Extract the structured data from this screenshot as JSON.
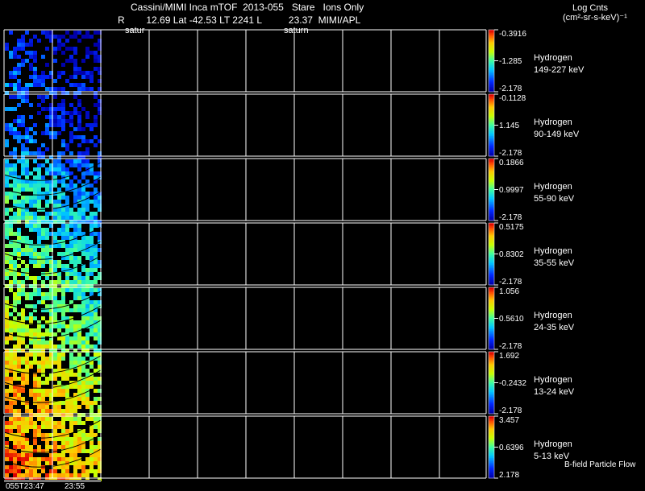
{
  "header": {
    "title": "Cassini/MIMI Inca mTOF  2013-055   Stare   Ions Only",
    "ephemeris": "R        12.69 Lat -42.53 LT 2241 L          23.37  MIMI/APL",
    "saturn_label_1": "satur",
    "saturn_label_2": "saturn",
    "units_title": "Log Cnts",
    "units": "(cm²-sr-s-keV)⁻¹"
  },
  "panels": [
    {
      "species": "Hydrogen",
      "energy": "149-227 keV",
      "cb_max": "-0.3916",
      "cb_mid": "-1.285",
      "cb_min": "-2.178",
      "level": 0.1
    },
    {
      "species": "Hydrogen",
      "energy": "90-149 keV",
      "cb_max": "-0.1128",
      "cb_mid": "1.145",
      "cb_min": "-2.178",
      "level": 0.15
    },
    {
      "species": "Hydrogen",
      "energy": "55-90 keV",
      "cb_max": "0.1866",
      "cb_mid": "0.9997",
      "cb_min": "-2.178",
      "level": 0.35
    },
    {
      "species": "Hydrogen",
      "energy": "35-55 keV",
      "cb_max": "0.5175",
      "cb_mid": "0.8302",
      "cb_min": "-2.178",
      "level": 0.45
    },
    {
      "species": "Hydrogen",
      "energy": "24-35 keV",
      "cb_max": "1.056",
      "cb_mid": "0.5610",
      "cb_min": "-2.178",
      "level": 0.55
    },
    {
      "species": "Hydrogen",
      "energy": "13-24 keV",
      "cb_max": "1.692",
      "cb_mid": "-0.2432",
      "cb_min": "-2.178",
      "level": 0.72
    },
    {
      "species": "Hydrogen",
      "energy": "5-13 keV",
      "cb_max": "3.457",
      "cb_mid": "0.6396",
      "cb_min": "2.178",
      "level": 0.8
    }
  ],
  "time_labels": [
    "055T23:47",
    "23:55"
  ],
  "footer_note": "B-field Particle Flow"
}
